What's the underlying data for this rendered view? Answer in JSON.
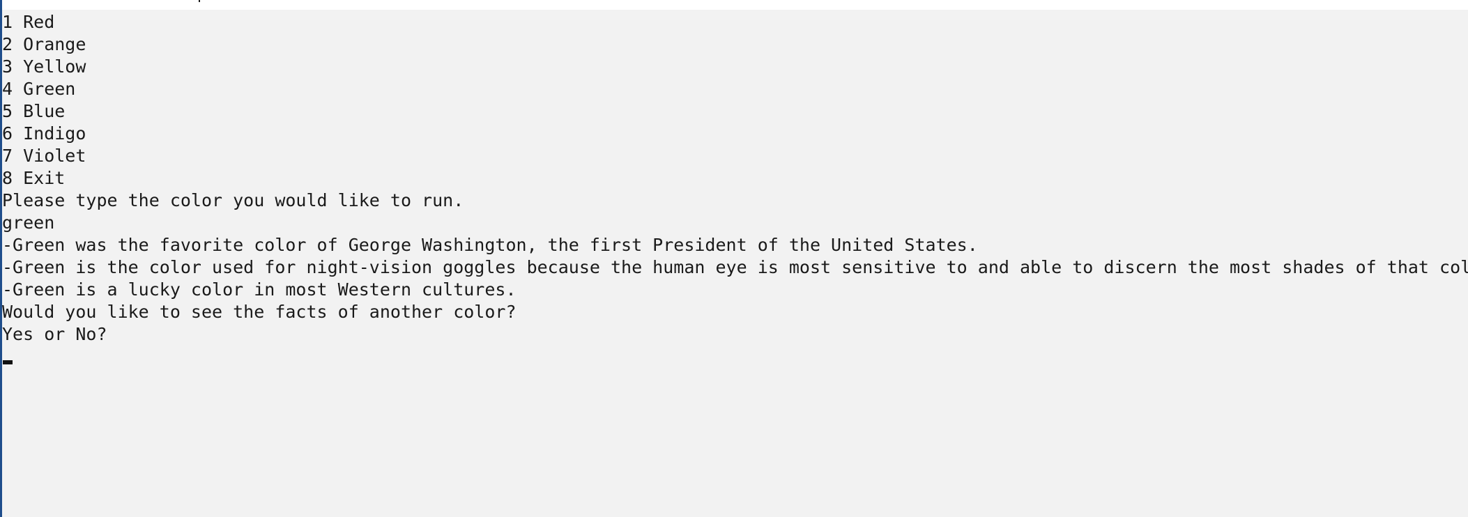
{
  "console": {
    "menu": [
      "1 Red",
      "2 Orange",
      "3 Yellow",
      "4 Green",
      "5 Blue",
      "6 Indigo",
      "7 Violet",
      "8 Exit"
    ],
    "prompt": "Please type the color you would like to run.",
    "user_input": "green",
    "facts": [
      "-Green was the favorite color of George Washington, the first President of the United States.",
      "-Green is the color used for night-vision goggles because the human eye is most sensitive to and able to discern the most shades of that colo",
      "-Green is a lucky color in most Western cultures."
    ],
    "followup_question": "Would you like to see the facts of another color?",
    "choice_prompt": "Yes or No?"
  },
  "colors": {
    "background": "#f2f2f2",
    "text": "#1a1a1a",
    "left_edge": "#1f4e8c"
  }
}
